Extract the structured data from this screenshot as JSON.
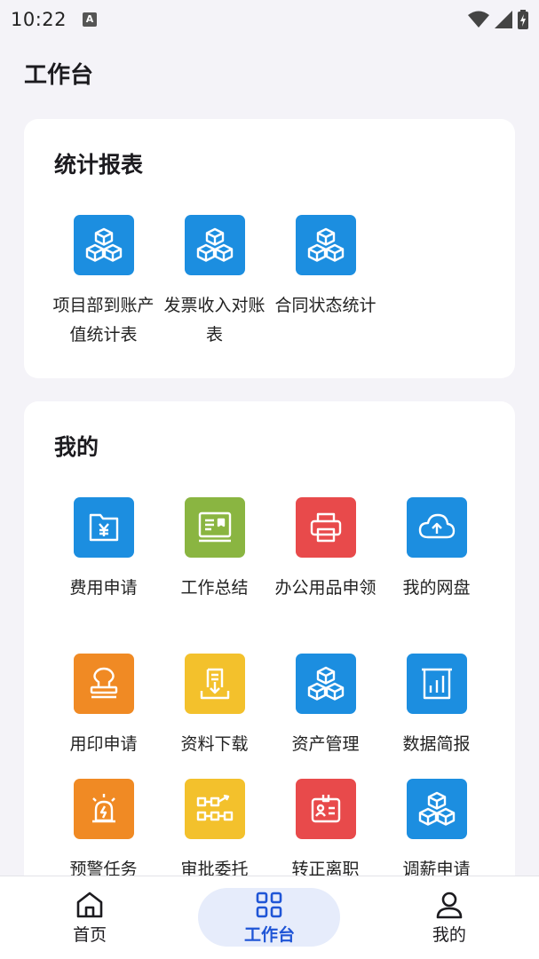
{
  "status_bar": {
    "time": "10:22",
    "notif_letter": "A"
  },
  "page_title": "工作台",
  "sections": {
    "reports": {
      "title": "统计报表",
      "items": [
        {
          "label": "项目部到账产值统计表",
          "icon": "cubes-icon",
          "color": "#1c8ee0"
        },
        {
          "label": "发票收入对账表",
          "icon": "cubes-icon",
          "color": "#1c8ee0"
        },
        {
          "label": "合同状态统计",
          "icon": "cubes-icon",
          "color": "#1c8ee0"
        }
      ]
    },
    "mine": {
      "title": "我的",
      "items": [
        {
          "label": "费用申请",
          "icon": "expense-folder-icon",
          "color": "#1c8ee0"
        },
        {
          "label": "工作总结",
          "icon": "report-board-icon",
          "color": "#8ab541"
        },
        {
          "label": "办公用品申领",
          "icon": "printer-icon",
          "color": "#e84a4b"
        },
        {
          "label": "我的网盘",
          "icon": "cloud-upload-icon",
          "color": "#1c8ee0"
        },
        {
          "label": "用印申请",
          "icon": "stamp-icon",
          "color": "#f08a24"
        },
        {
          "label": "资料下载",
          "icon": "download-doc-icon",
          "color": "#f3c12c"
        },
        {
          "label": "资产管理",
          "icon": "cubes-icon",
          "color": "#1c8ee0"
        },
        {
          "label": "数据简报",
          "icon": "bar-chart-icon",
          "color": "#1c8ee0"
        },
        {
          "label": "预警任务",
          "icon": "alarm-icon",
          "color": "#f08a24"
        },
        {
          "label": "审批委托",
          "icon": "workflow-icon",
          "color": "#f3c12c"
        },
        {
          "label": "转正离职",
          "icon": "id-card-icon",
          "color": "#e84a4b"
        },
        {
          "label": "调薪申请",
          "icon": "cubes-icon",
          "color": "#1c8ee0"
        }
      ]
    }
  },
  "bottom_nav": [
    {
      "label": "首页",
      "icon": "home-icon",
      "active": false
    },
    {
      "label": "工作台",
      "icon": "grid-icon",
      "active": true
    },
    {
      "label": "我的",
      "icon": "person-icon",
      "active": false
    }
  ]
}
